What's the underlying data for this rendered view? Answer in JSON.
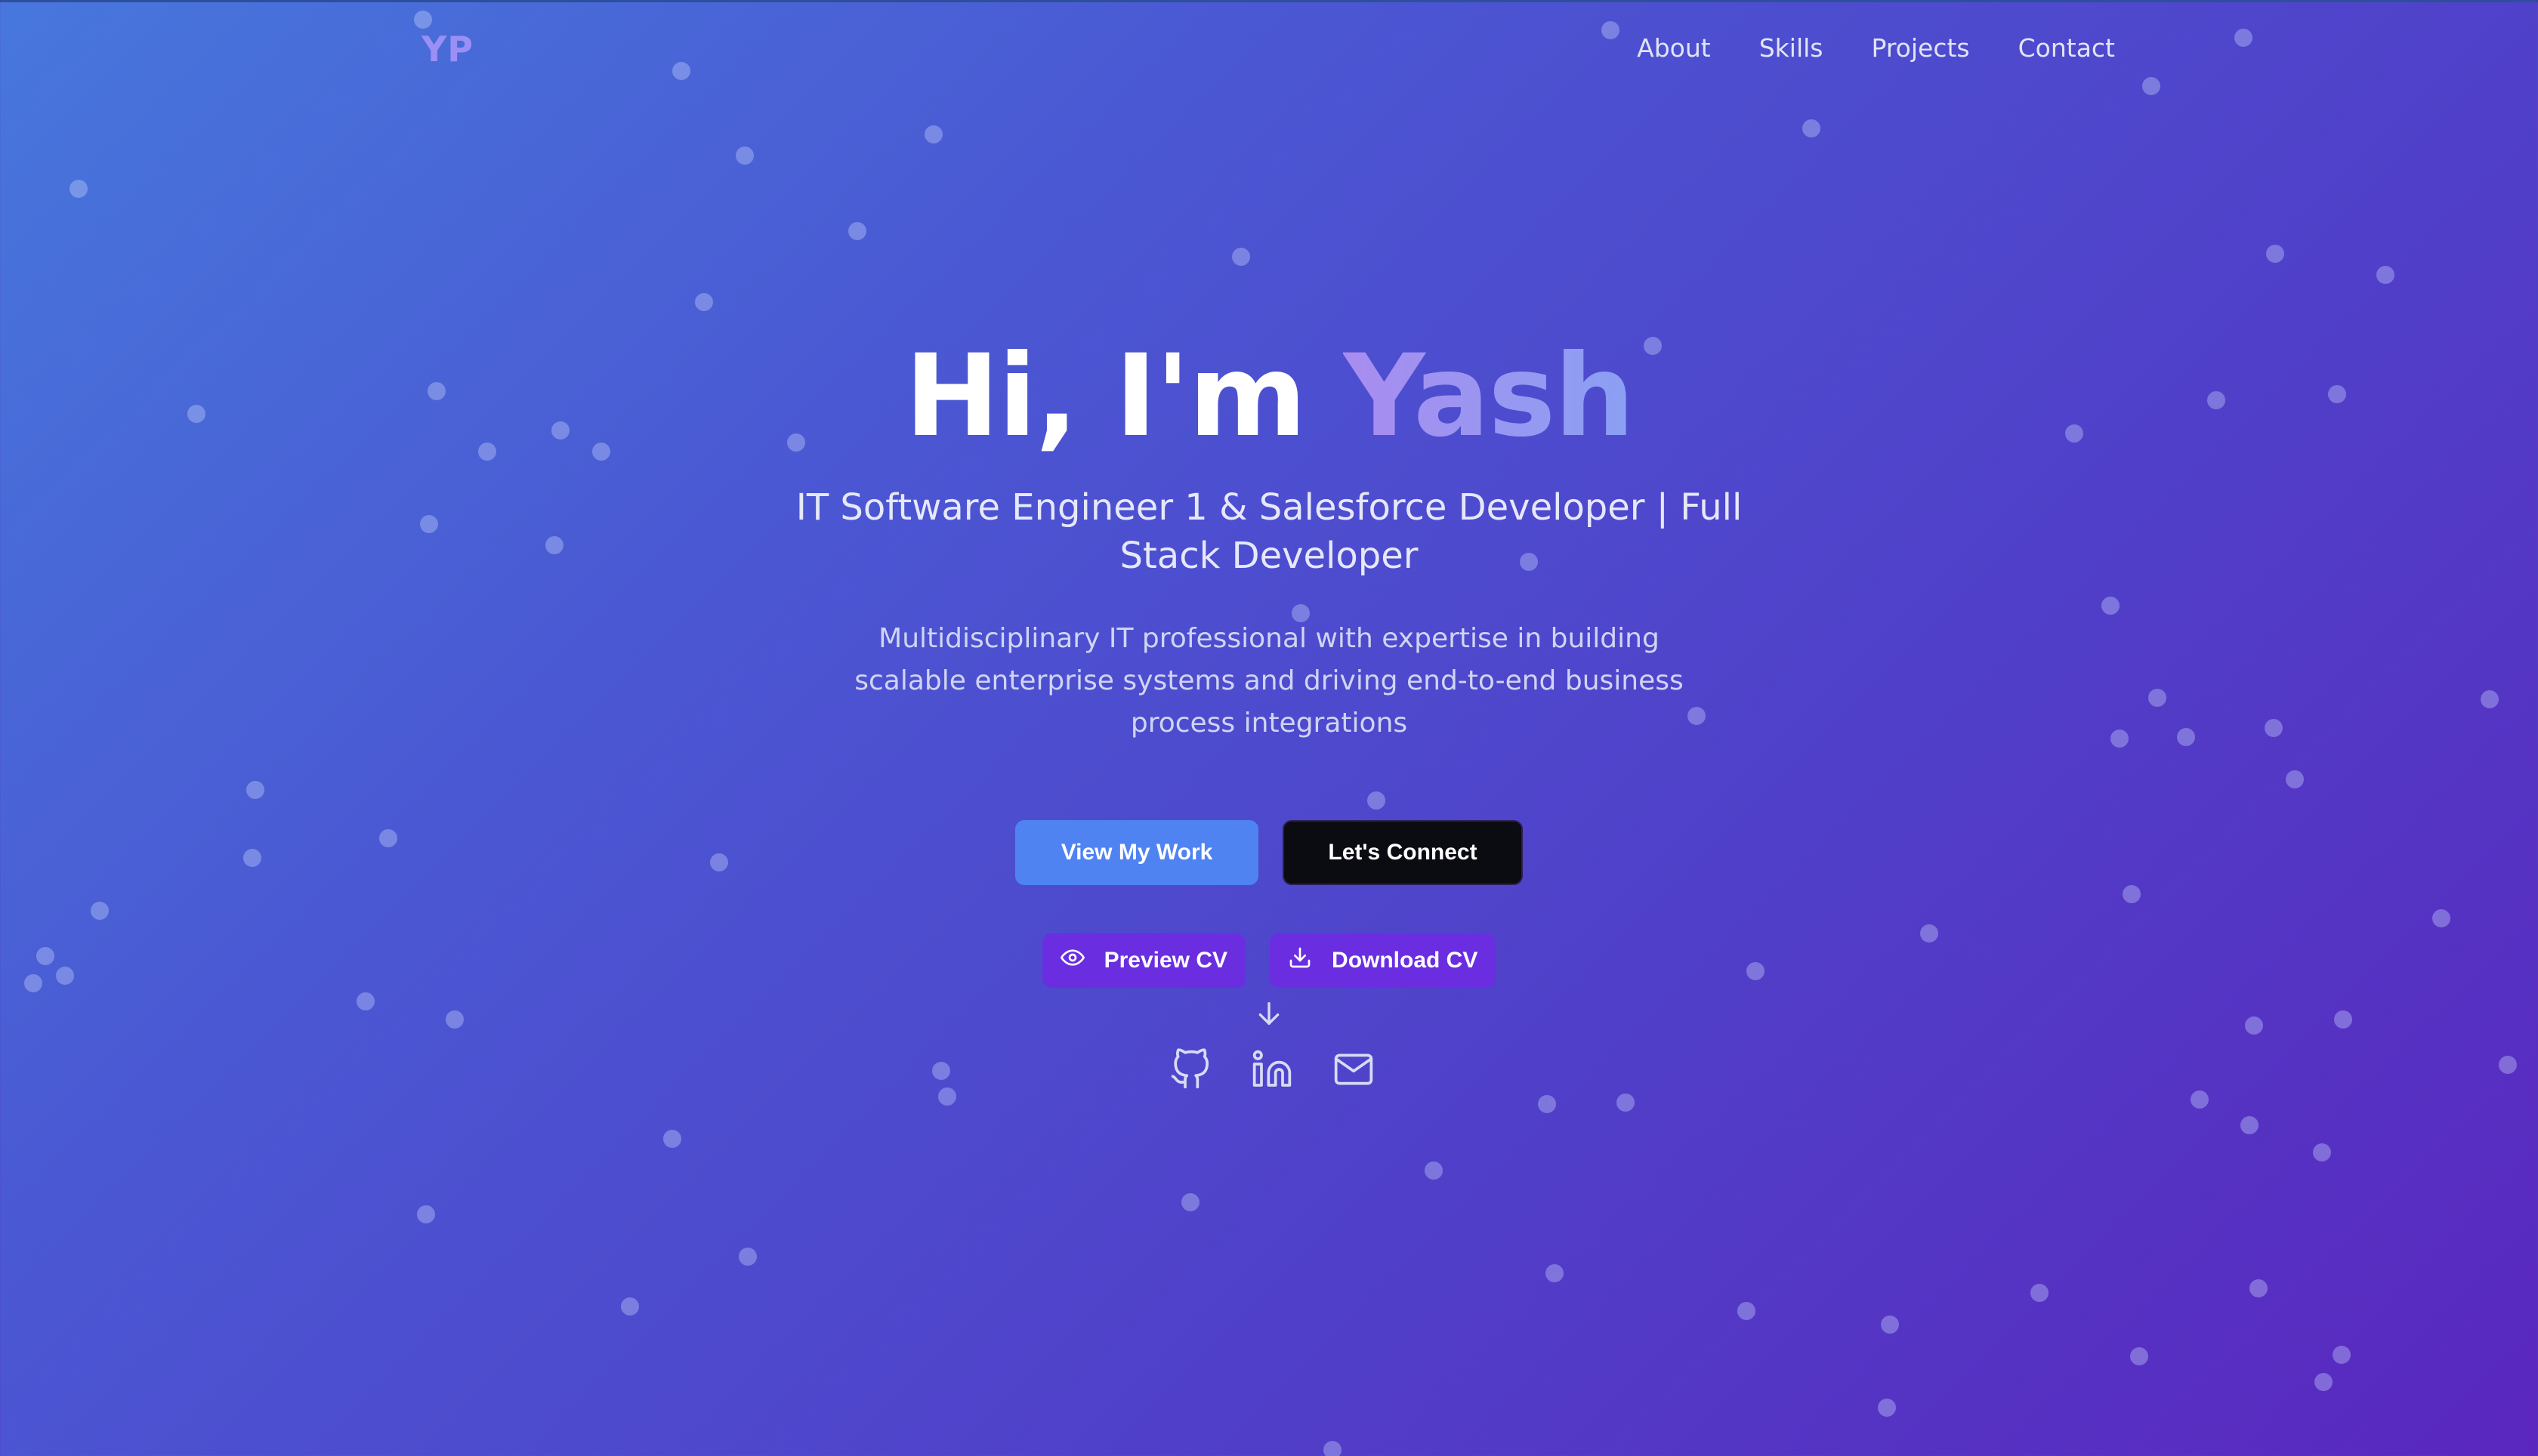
{
  "brand": {
    "logo_text": "YP",
    "logo_color": "#9a8ff5"
  },
  "nav": {
    "items": [
      "About",
      "Skills",
      "Projects",
      "Contact"
    ]
  },
  "hero": {
    "greeting": "Hi, I'm",
    "name": "Yash",
    "subtitle": "IT Software Engineer 1 & Salesforce Developer | Full Stack Developer",
    "description": "Multidisciplinary IT professional with expertise in building scalable enterprise systems and driving end-to-end business process integrations"
  },
  "buttons": {
    "view_work": "View My Work",
    "connect": "Let's Connect",
    "preview_cv": "Preview CV",
    "download_cv": "Download CV"
  },
  "icons": [
    "eye-icon",
    "download-icon",
    "arrow-down-icon",
    "github-icon",
    "linkedin-icon",
    "mail-icon"
  ],
  "colors": {
    "gradient_start": "#4777dc",
    "gradient_end": "#5a27be",
    "primary_button": "#4f83f2",
    "dark_button": "#0b0b12",
    "cv_button": "#6a2ee0",
    "name_gradient": [
      "#a98cf0",
      "#8aa0f3"
    ]
  }
}
